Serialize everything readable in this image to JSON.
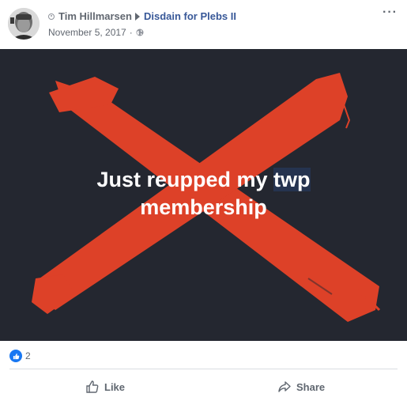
{
  "post": {
    "author": "Tim Hillmarsen",
    "group": "Disdain for Plebs II",
    "date": "November 5, 2017",
    "date_separator": "·",
    "more_label": "···",
    "icons": {
      "presence": "presence-icon",
      "arrow": "triangle-right-icon",
      "privacy": "globe-icon",
      "avatar": "profile-photo"
    }
  },
  "image": {
    "caption_line1_part1": "Just reupped my ",
    "caption_highlight": "twp",
    "caption_line2": "membership",
    "colors": {
      "background": "#242730",
      "x_color": "#dd4128",
      "highlight": "#25334f"
    }
  },
  "reactions": {
    "count": "2",
    "icon": "like-reaction-icon"
  },
  "actions": {
    "like_label": "Like",
    "share_label": "Share"
  },
  "colors": {
    "link": "#385898",
    "meta": "#616770",
    "accent": "#1877f2"
  }
}
